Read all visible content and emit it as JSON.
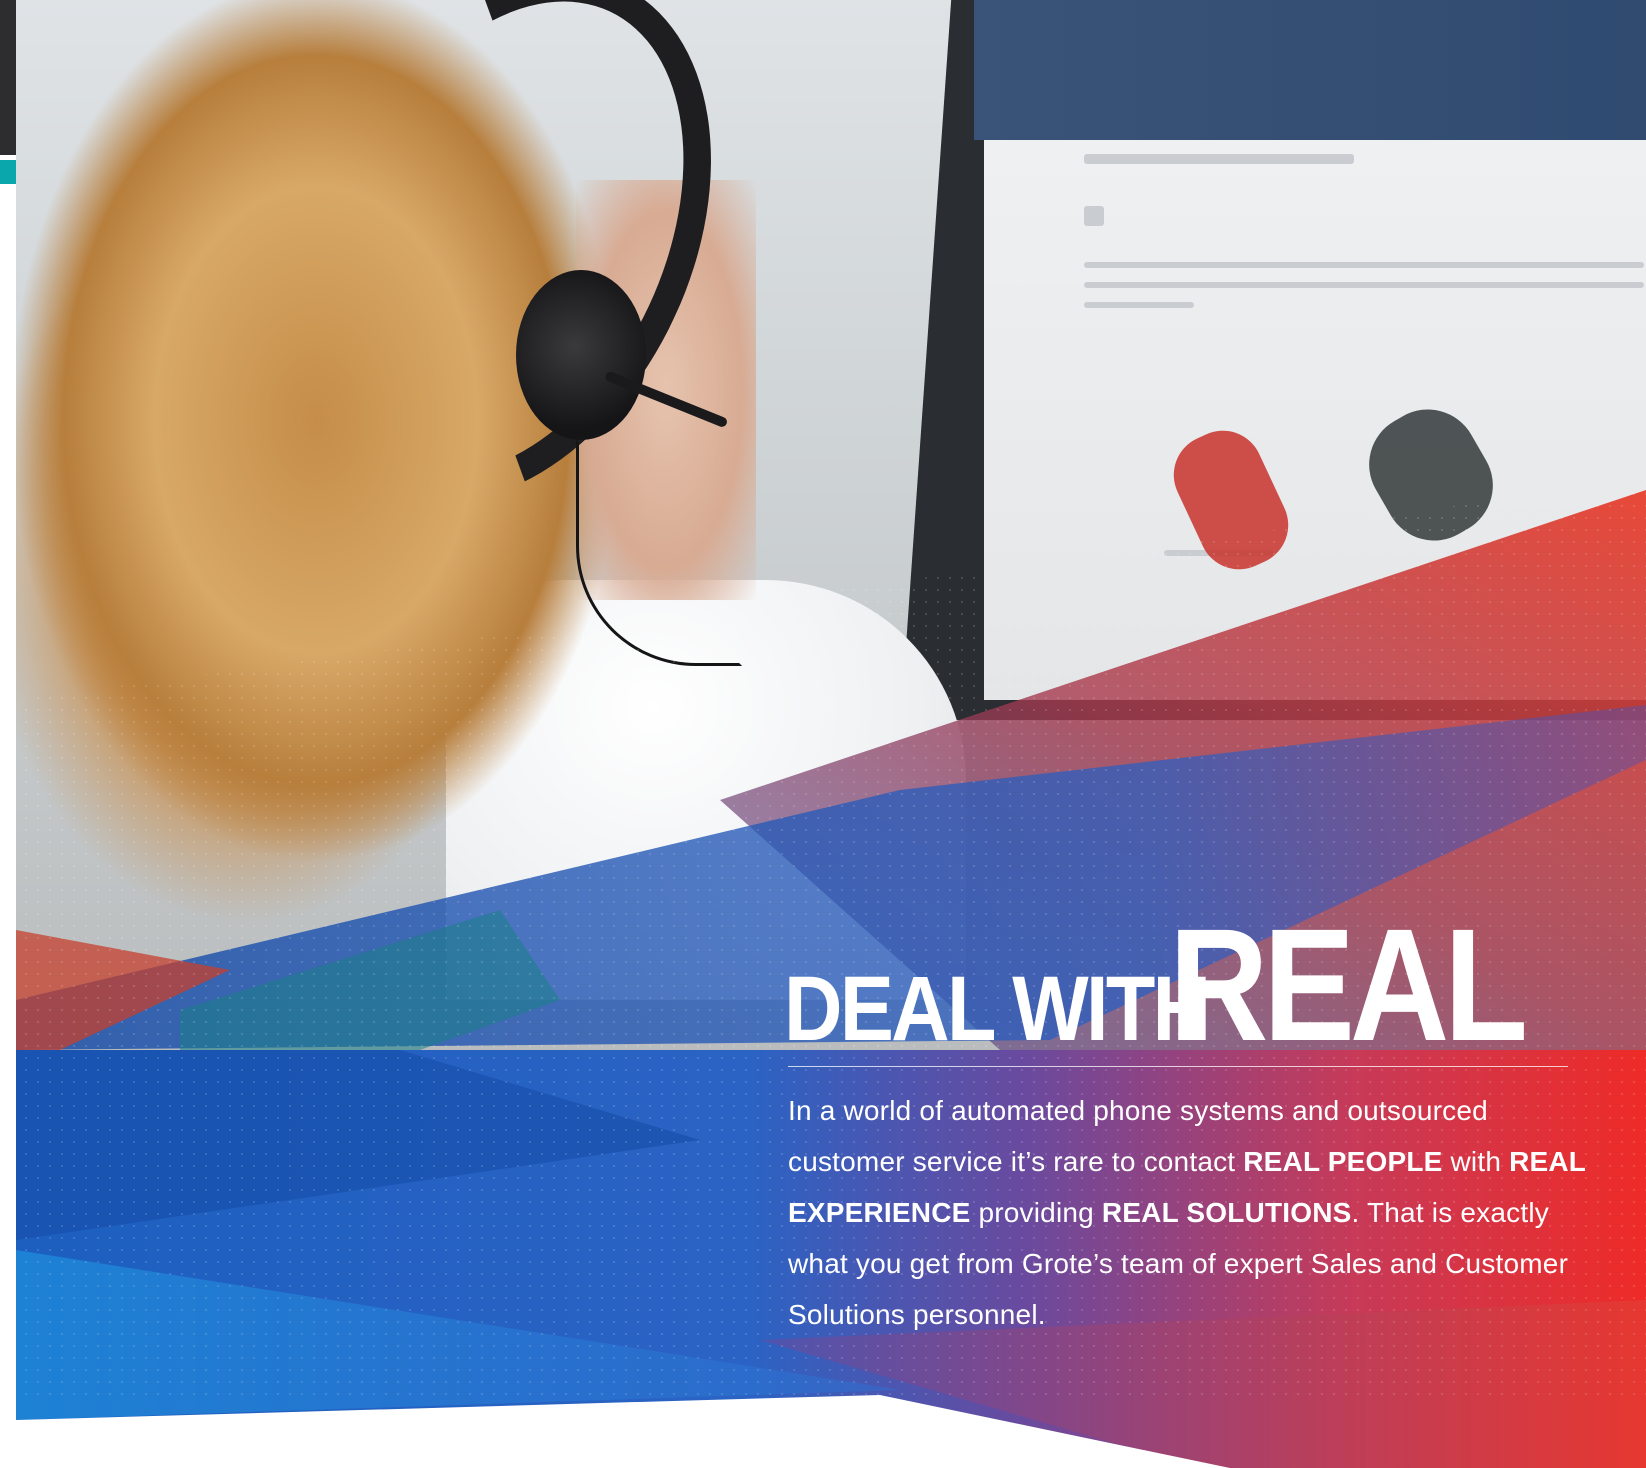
{
  "headline": {
    "part1": "DEAL WITH",
    "part2": "REAL"
  },
  "body": {
    "t1": "In a world of automated phone systems and outsourced customer service it’s rare to contact ",
    "b1": "REAL PEOPLE",
    "t2": " with ",
    "b2": "REAL EXPERIENCE",
    "t3": " providing ",
    "b3": "REAL SOLUTIONS",
    "t4": ". That is exactly what you get from Grote’s team of expert Sales and Customer Solutions personnel."
  },
  "colors": {
    "blue": "#1f5fbf",
    "red": "#e8302e",
    "purple": "#6a4a8e",
    "teal": "#0aa7ad"
  },
  "photo": {
    "subject": "woman-with-headset-icon"
  }
}
